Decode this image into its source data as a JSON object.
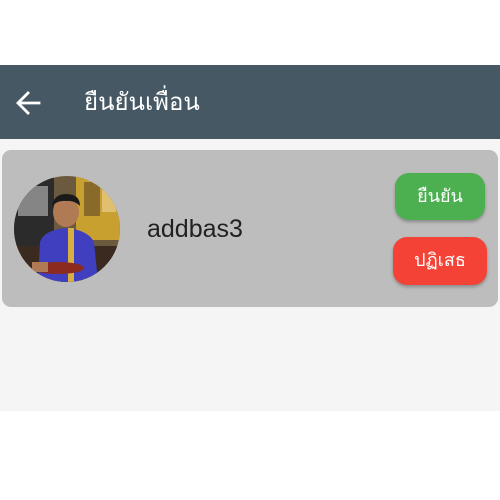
{
  "app_bar": {
    "title": "ยืนยันเพื่อน",
    "back_icon": "arrow-back-icon",
    "background_color": "#465863"
  },
  "friend_requests": [
    {
      "username": "addbas3",
      "avatar": "user-avatar-photo",
      "confirm_label": "ยืนยัน",
      "reject_label": "ปฏิเสธ"
    }
  ],
  "colors": {
    "confirm": "#4caf50",
    "reject": "#f44336",
    "card": "#bdbdbd"
  }
}
